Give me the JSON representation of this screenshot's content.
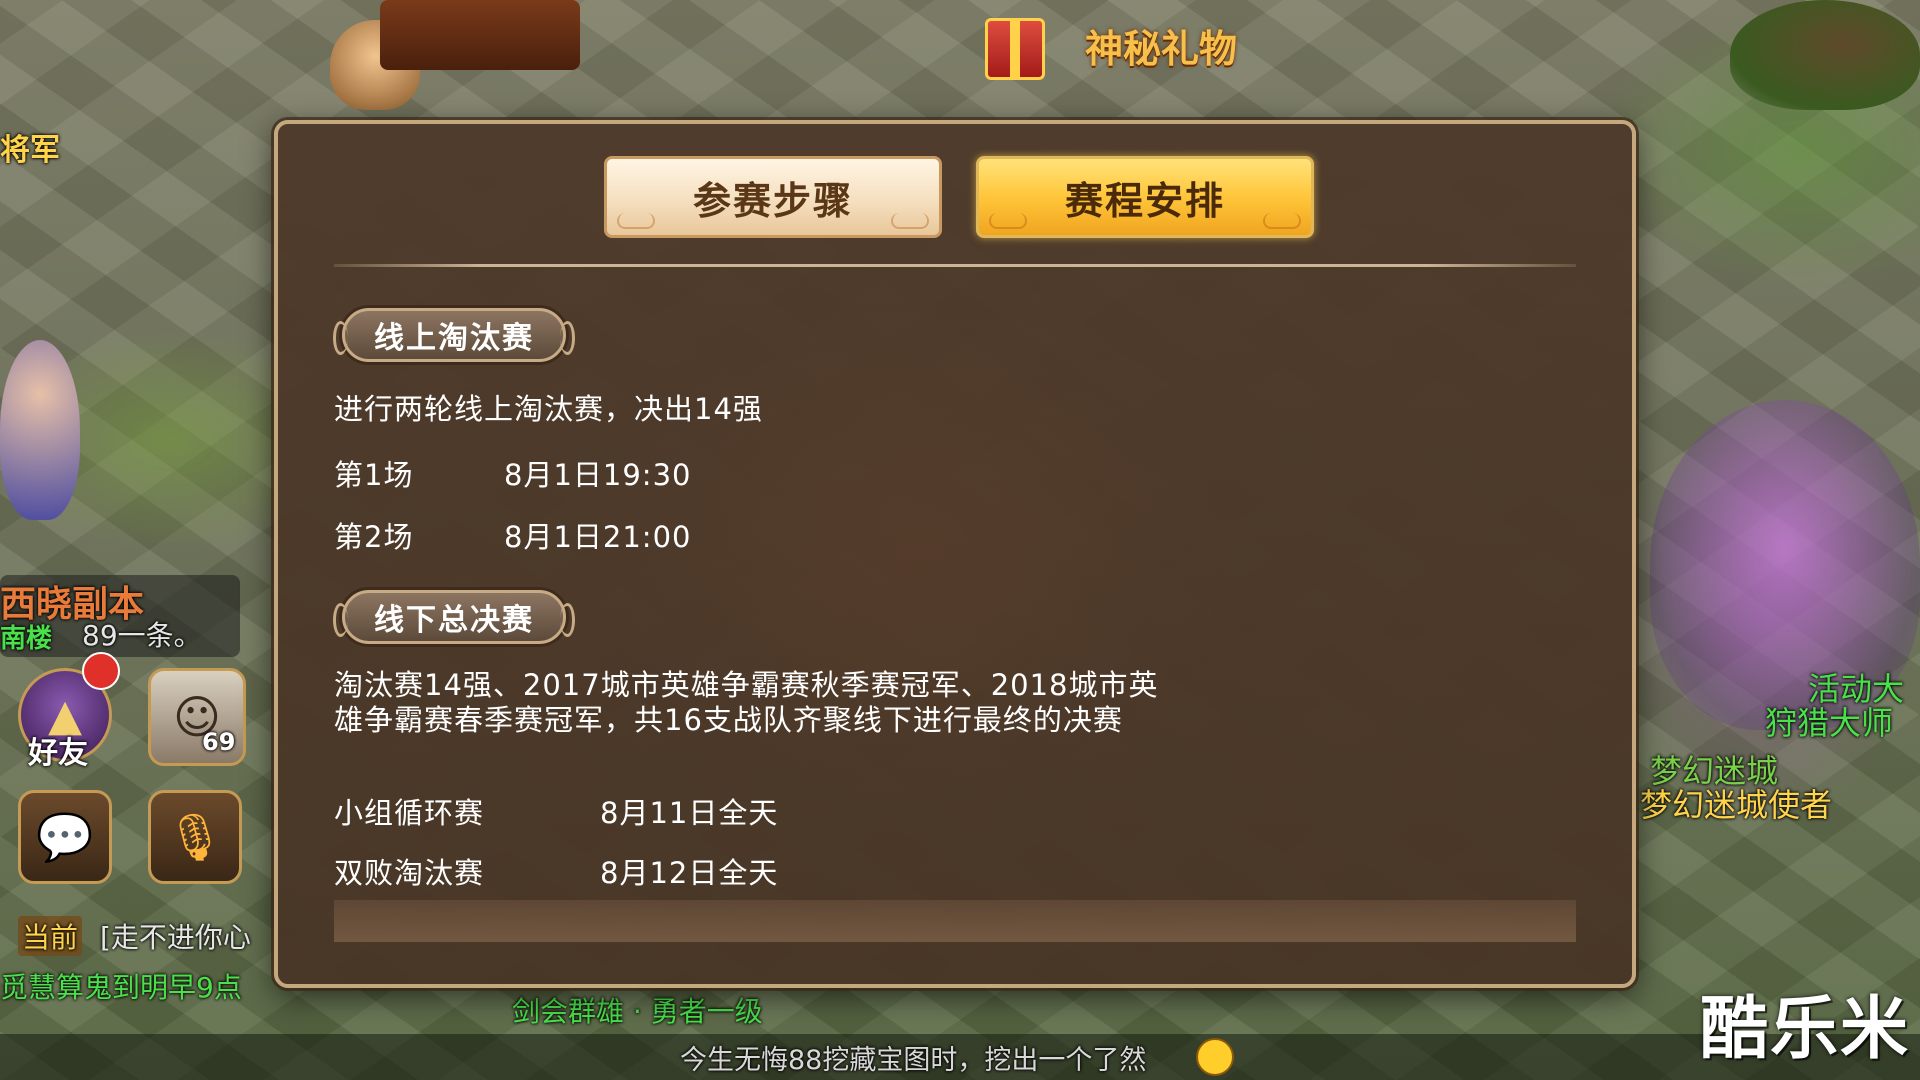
{
  "world": {
    "gift_title": "神秘礼物",
    "npc_label_left": "将军",
    "dungeon_label": "西晓副本",
    "hud_count": "89一条。",
    "hud_count_prefix": "南楼",
    "friends_label": "好友",
    "avatar_level": "69",
    "chat_tab_current": "当前",
    "chat_line_1": "[走不进你心",
    "chat_line_2": "觅慧算鬼到明早9点",
    "chat_line_3": "剑会群雄 · 勇者一级",
    "chat_line_4": "今生无悔88挖藏宝图时，挖出一个了然",
    "right_label_1": "活动大",
    "right_label_2": "狩猎大师",
    "right_label_3": "梦幻迷城",
    "right_label_4": "梦幻迷城使者",
    "watermark": "酷乐米"
  },
  "modal": {
    "tabs": {
      "steps_label": "参赛步骤",
      "schedule_label": "赛程安排"
    },
    "online": {
      "title": "线上淘汰赛",
      "description": "进行两轮线上淘汰赛，决出14强",
      "rounds": [
        {
          "name": "第1场",
          "time": "8月1日19:30"
        },
        {
          "name": "第2场",
          "time": "8月1日21:00"
        }
      ]
    },
    "offline": {
      "title": "线下总决赛",
      "description_line1": "淘汰赛14强、2017城市英雄争霸赛秋季赛冠军、2018城市英",
      "description_line2": "雄争霸赛春季赛冠军，共16支战队齐聚线下进行最终的决赛",
      "stages": [
        {
          "name": "小组循环赛",
          "time": "8月11日全天"
        },
        {
          "name": "双败淘汰赛",
          "time": "8月12日全天"
        }
      ]
    }
  },
  "colors": {
    "panel_bg": "#4e3a2a",
    "panel_border": "#c6a87f",
    "tab_active": "#ffc63a",
    "tab_inactive": "#f5dfbf",
    "gold_text": "#ffd34a"
  }
}
